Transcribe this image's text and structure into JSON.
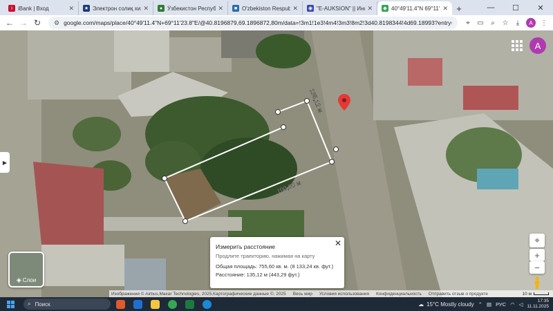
{
  "browser": {
    "tabs": [
      {
        "title": "iBank | Вход",
        "favicon_color": "#c8102e",
        "favicon_glyph": "i"
      },
      {
        "title": "Электрон солиқ хизматлари",
        "favicon_color": "#1a3a7a",
        "favicon_glyph": "★"
      },
      {
        "title": "Ўзбекистон Республикаси",
        "favicon_color": "#2e7d32",
        "favicon_glyph": "●"
      },
      {
        "title": "O'zbekiston Respublikasi ",
        "favicon_color": "#2b6cb0",
        "favicon_glyph": "■"
      },
      {
        "title": "\"E-AUKSION\" || Информация",
        "favicon_color": "#3949ab",
        "favicon_glyph": "◉"
      },
      {
        "title": "40°49'11.4\"N 69°11'23.8\"E",
        "favicon_color": "#34a853",
        "favicon_glyph": "◆",
        "active": true
      }
    ],
    "new_tab_label": "+",
    "url": "google.com/maps/place/40°49'11.4\"N+69°11'23.8\"E/@40.8196879,69.1896872,80m/data=!3m1!1e3!4m4!3m3!8m2!3d40.8198344!4d69.18993?entry=ttu&g_ep=EgoyMDI1MTEwNS",
    "profile_initial": "A"
  },
  "map": {
    "measure_label_short": "135,12 м",
    "measure_label_long": "100,00 м",
    "account_initial": "A",
    "layers_label": "Слои",
    "zoom_in": "+",
    "zoom_out": "−"
  },
  "measure_card": {
    "title": "Измерить расстояние",
    "hint": "Продлите траекторию, нажимая на карту",
    "area": "Общая площадь: 755,60 кв. м. (8 133,24 кв. фут.)",
    "distance": "Расстояние: 135,12 м (443,29 фут.)"
  },
  "attribution": {
    "imagery": "Изображения © Airbus,Maxar Technologies, 2025,Картографические данные ©, 2025",
    "links": [
      "Весь мир",
      "Условия использования",
      "Конфиденциальность",
      "Отправить отзыв о продукте"
    ],
    "scale": "10 м"
  },
  "taskbar": {
    "search_placeholder": "Поиск",
    "weather": "15°C  Mostly cloudy",
    "lang": "РУС",
    "time": "17:35",
    "date": "11.11.2025",
    "app_colors": [
      "#e05a2b",
      "#1f6fd0",
      "#f5c542",
      "#34a853",
      "#1d7a3f",
      "#1b8ad6"
    ]
  }
}
